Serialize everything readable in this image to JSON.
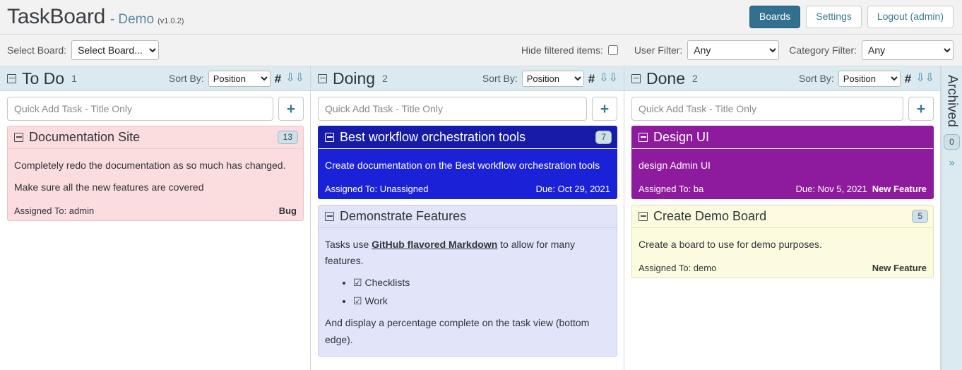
{
  "header": {
    "app_title": "TaskBoard",
    "separator": "-",
    "board_name": "Demo",
    "version": "(v1.0.2)",
    "boards_label": "Boards",
    "settings_label": "Settings",
    "logout_label": "Logout (admin)",
    "accent_color": "#31708f"
  },
  "filterbar": {
    "select_board_label": "Select Board:",
    "board_select_value": "Select Board...",
    "hide_filtered_label": "Hide filtered items:",
    "hide_filtered_checked": false,
    "user_filter_label": "User Filter:",
    "user_filter_value": "Any",
    "category_filter_label": "Category Filter:",
    "category_filter_value": "Any"
  },
  "common": {
    "sort_by_label": "Sort By:",
    "sort_value": "Position",
    "quick_add_placeholder": "Quick Add Task - Title Only",
    "add_button_label": "+",
    "hash_icon": "#",
    "chevron_icon": "»",
    "assigned_prefix": "Assigned To: "
  },
  "columns": [
    {
      "name": "To Do",
      "count": "1",
      "cards": [
        {
          "title": "Documentation Site",
          "badge": "13",
          "body_lines": [
            "Completely redo the documentation as so much has changed.",
            "Make sure all the new features are covered"
          ],
          "assigned": "Assigned To: admin",
          "due": "",
          "category": "Bug",
          "color": "pink"
        }
      ]
    },
    {
      "name": "Doing",
      "count": "2",
      "cards": [
        {
          "title": "Best workflow orchestration tools",
          "badge": "7",
          "body_lines": [
            "Create documentation on the Best workflow orchestration tools"
          ],
          "assigned": "Assigned To: Unassigned",
          "due": "Due: Oct 29, 2021",
          "category": "",
          "color": "blue"
        },
        {
          "title": "Demonstrate Features",
          "badge": "",
          "intro_before_link": "Tasks use ",
          "intro_link": "GitHub flavored Markdown",
          "intro_after_link": " to allow for many features.",
          "checklist": [
            "Checklists",
            "Work"
          ],
          "closing_text": "And display a percentage complete on the task view (bottom edge).",
          "assigned": "",
          "due": "",
          "category": "",
          "color": "lavender"
        }
      ]
    },
    {
      "name": "Done",
      "count": "2",
      "cards": [
        {
          "title": "Design UI",
          "badge": "",
          "body_lines": [
            "design Admin UI"
          ],
          "assigned": "Assigned To: ba",
          "due": "Due: Nov 5, 2021",
          "category": "New Feature",
          "color": "purple"
        },
        {
          "title": "Create Demo Board",
          "badge": "5",
          "body_lines": [
            "Create a board to use for demo purposes."
          ],
          "assigned": "Assigned To: demo",
          "due": "",
          "category": "New Feature",
          "color": "cream"
        }
      ]
    }
  ],
  "archived": {
    "label": "Archived",
    "count": "0",
    "chevron": "»"
  }
}
